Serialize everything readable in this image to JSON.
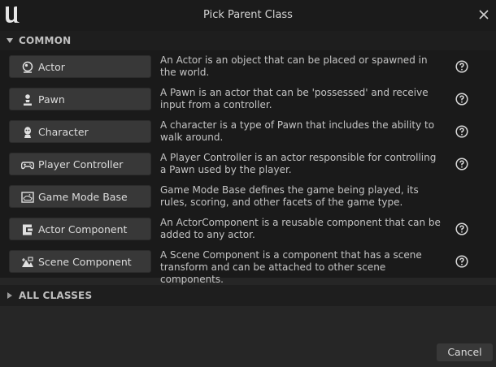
{
  "window": {
    "title": "Pick Parent Class",
    "logo_icon": "unreal-logo-icon",
    "close_icon": "close-icon"
  },
  "sections": {
    "common": {
      "label": "COMMON",
      "expanded": true
    },
    "all_classes": {
      "label": "ALL CLASSES",
      "expanded": false
    }
  },
  "classes": [
    {
      "label": "Actor",
      "icon": "actor-sphere-icon",
      "description": "An Actor is an object that can be placed or spawned in the world.",
      "has_help": true
    },
    {
      "label": "Pawn",
      "icon": "pawn-icon",
      "description": "A Pawn is an actor that can be 'possessed' and receive input from a controller.",
      "has_help": true
    },
    {
      "label": "Character",
      "icon": "character-icon",
      "description": "A character is a type of Pawn that includes the ability to walk around.",
      "has_help": true
    },
    {
      "label": "Player Controller",
      "icon": "gamepad-icon",
      "description": "A Player Controller is an actor responsible for controlling a Pawn used by the player.",
      "has_help": true
    },
    {
      "label": "Game Mode Base",
      "icon": "game-mode-icon",
      "description": "Game Mode Base defines the game being played, its rules, scoring, and other facets of the game type.",
      "has_help": false
    },
    {
      "label": "Actor Component",
      "icon": "actor-component-icon",
      "description": "An ActorComponent is a reusable component that can be added to any actor.",
      "has_help": true
    },
    {
      "label": "Scene Component",
      "icon": "scene-component-icon",
      "description": "A Scene Component is a component that has a scene transform and can be attached to other scene components.",
      "has_help": true
    }
  ],
  "footer": {
    "cancel_label": "Cancel"
  },
  "colors": {
    "background": "#262626",
    "titlebar": "#1b1b1b",
    "list_background": "#1a1a1a",
    "button": "#383838",
    "text": "#c8c8c8"
  }
}
